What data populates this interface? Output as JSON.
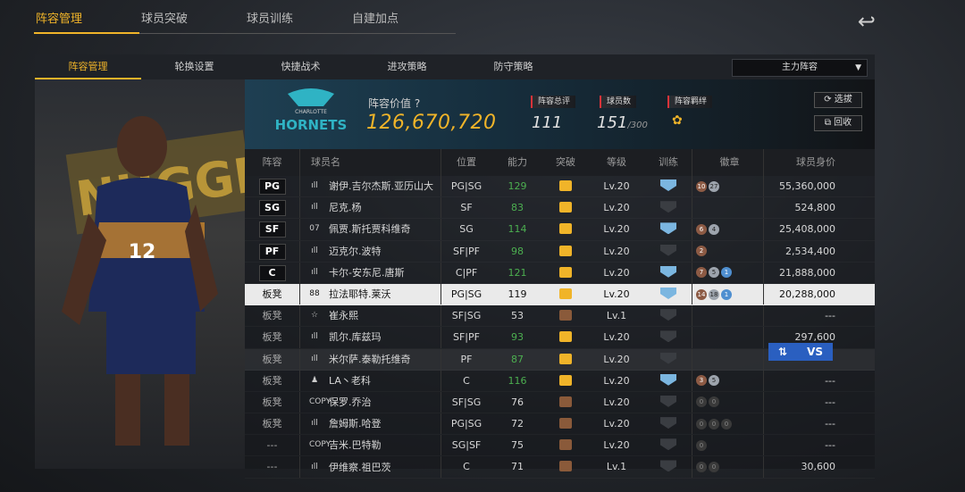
{
  "top_tabs": [
    "阵容管理",
    "球员突破",
    "球员训练",
    "自建加点"
  ],
  "sub_tabs": [
    "阵容管理",
    "轮换设置",
    "快捷战术",
    "进攻策略",
    "防守策略"
  ],
  "lineup_select": "主力阵容",
  "summary": {
    "value_label": "阵容价值",
    "value": "126,670,720",
    "rating_label": "阵容总评",
    "rating": "111",
    "count_label": "球员数",
    "count": "151",
    "count_max": "/300",
    "bond_label": "阵容羁绊",
    "select_btn": "选拔",
    "recycle_btn": "回收"
  },
  "team_logo": {
    "top": "CHARLOTTE",
    "name": "HORNETS"
  },
  "player_art": {
    "jersey": "12",
    "banner": "NUGGETS"
  },
  "columns": [
    "阵容",
    "球员名",
    "位置",
    "能力",
    "突破",
    "等级",
    "训练",
    "徽章",
    "球员身价"
  ],
  "rows": [
    {
      "slot": "PG",
      "icon": "ıll",
      "name": "谢伊.吉尔杰斯.亚历山大",
      "pos": "PG|SG",
      "ovr": "129",
      "lv": "Lv.20",
      "price": "55,360,000",
      "badges": [
        [
          "b-br",
          "10"
        ],
        [
          "b-sv",
          "27"
        ]
      ],
      "green": true,
      "train": "blue",
      "brk": "gold"
    },
    {
      "slot": "SG",
      "icon": "ıll",
      "name": "尼克.杨",
      "pos": "SF",
      "ovr": "83",
      "lv": "Lv.20",
      "price": "524,800",
      "badges": [],
      "green": true,
      "train": "dark",
      "brk": "gold"
    },
    {
      "slot": "SF",
      "icon": "07",
      "name": "佩贾.斯托贾科维奇",
      "pos": "SG",
      "ovr": "114",
      "lv": "Lv.20",
      "price": "25,408,000",
      "badges": [
        [
          "b-br",
          "6"
        ],
        [
          "b-sv",
          "4"
        ]
      ],
      "green": true,
      "train": "blue",
      "brk": "gold"
    },
    {
      "slot": "PF",
      "icon": "ıll",
      "name": "迈克尔.波特",
      "pos": "SF|PF",
      "ovr": "98",
      "lv": "Lv.20",
      "price": "2,534,400",
      "badges": [
        [
          "b-br",
          "2"
        ]
      ],
      "green": true,
      "train": "dark",
      "brk": "gold"
    },
    {
      "slot": "C",
      "icon": "ıll",
      "name": "卡尔-安东尼.唐斯",
      "pos": "C|PF",
      "ovr": "121",
      "lv": "Lv.20",
      "price": "21,888,000",
      "badges": [
        [
          "b-br",
          "7"
        ],
        [
          "b-sv",
          "5"
        ],
        [
          "b-bl",
          "1"
        ]
      ],
      "green": true,
      "train": "blue",
      "brk": "gold"
    },
    {
      "slot": "板凳",
      "icon": "88",
      "name": "拉法耶特.莱沃",
      "pos": "PG|SG",
      "ovr": "119",
      "lv": "Lv.20",
      "price": "20,288,000",
      "badges": [
        [
          "b-br",
          "14"
        ],
        [
          "b-sv",
          "18"
        ],
        [
          "b-bl",
          "1"
        ]
      ],
      "green": false,
      "train": "blue",
      "brk": "gold",
      "sel": true
    },
    {
      "slot": "板凳",
      "icon": "☆",
      "name": "崔永熙",
      "pos": "SF|SG",
      "ovr": "53",
      "lv": "Lv.1",
      "price": "---",
      "badges": [],
      "green": false,
      "train": "dark",
      "brk": "bronze"
    },
    {
      "slot": "板凳",
      "icon": "ıll",
      "name": "凯尔.库兹玛",
      "pos": "SF|PF",
      "ovr": "93",
      "lv": "Lv.20",
      "price": "297,600",
      "badges": [],
      "green": true,
      "train": "dark",
      "brk": "gold"
    },
    {
      "slot": "板凳",
      "icon": "ıll",
      "name": "米尔萨.泰勒托维奇",
      "pos": "PF",
      "ovr": "87",
      "lv": "Lv.20",
      "price": "",
      "badges": [],
      "green": true,
      "train": "dark",
      "brk": "gold",
      "dim": true
    },
    {
      "slot": "板凳",
      "icon": "♟",
      "name": "LA丶老科",
      "pos": "C",
      "ovr": "116",
      "lv": "Lv.20",
      "price": "---",
      "badges": [
        [
          "b-br",
          "3"
        ],
        [
          "b-sv",
          "5"
        ]
      ],
      "green": true,
      "train": "blue5",
      "brk": "gold"
    },
    {
      "slot": "板凳",
      "icon": "COPY",
      "name": "保罗.乔治",
      "pos": "SF|SG",
      "ovr": "76",
      "lv": "Lv.20",
      "price": "---",
      "badges": [
        [
          "b-dk",
          "0"
        ],
        [
          "b-dk",
          "0"
        ]
      ],
      "green": false,
      "train": "dark",
      "brk": "bronze"
    },
    {
      "slot": "板凳",
      "icon": "ıll",
      "name": "詹姆斯.哈登",
      "pos": "PG|SG",
      "ovr": "72",
      "lv": "Lv.20",
      "price": "---",
      "badges": [
        [
          "b-dk",
          "0"
        ],
        [
          "b-dk",
          "0"
        ],
        [
          "b-dk",
          "0"
        ]
      ],
      "green": false,
      "train": "dark",
      "brk": "bronze"
    },
    {
      "slot": "---",
      "icon": "COPY",
      "name": "吉米.巴特勒",
      "pos": "SG|SF",
      "ovr": "75",
      "lv": "Lv.20",
      "price": "---",
      "badges": [
        [
          "b-dk",
          "0"
        ]
      ],
      "green": false,
      "train": "dark",
      "brk": "bronze"
    },
    {
      "slot": "---",
      "icon": "ıll",
      "name": "伊维察.祖巴茨",
      "pos": "C",
      "ovr": "71",
      "lv": "Lv.1",
      "price": "30,600",
      "badges": [
        [
          "b-dk",
          "0"
        ],
        [
          "b-dk",
          "0"
        ]
      ],
      "green": false,
      "train": "dark",
      "brk": "bronze"
    }
  ],
  "vs_label": "VS",
  "vs_swap": "⇅"
}
